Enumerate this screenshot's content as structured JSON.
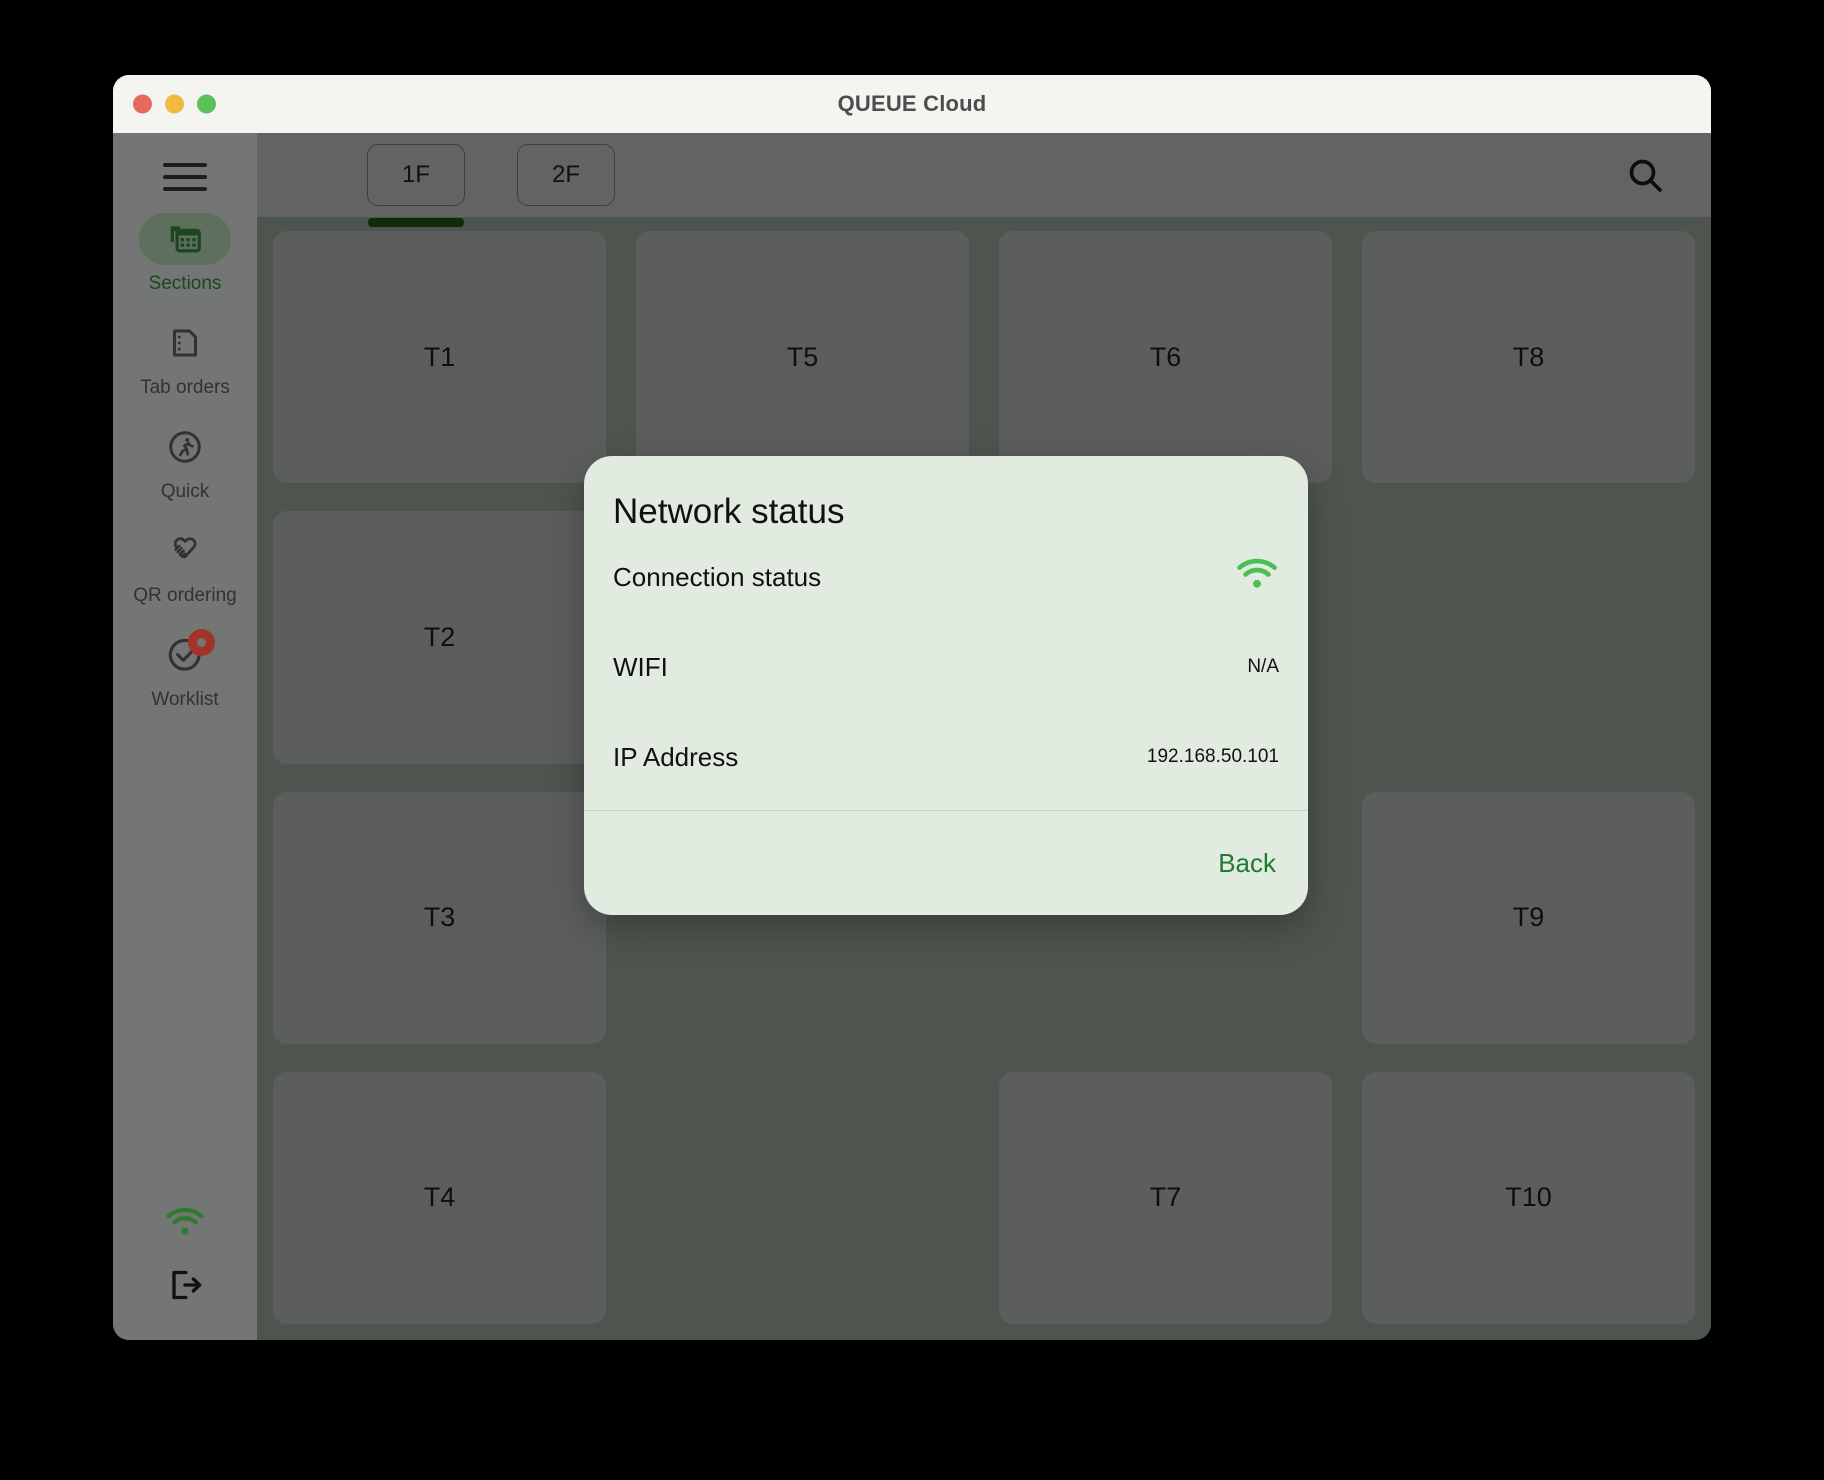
{
  "window": {
    "title": "QUEUE Cloud",
    "traffic_lights": [
      "close",
      "minimize",
      "maximize"
    ]
  },
  "sidebar": {
    "menu_icon": "hamburger-icon",
    "items": [
      {
        "label": "Sections",
        "icon": "sections-icon",
        "active": true,
        "badge": false
      },
      {
        "label": "Tab orders",
        "icon": "document-icon",
        "active": false,
        "badge": false
      },
      {
        "label": "Quick",
        "icon": "runner-icon",
        "active": false,
        "badge": false
      },
      {
        "label": "QR ordering",
        "icon": "handshake-icon",
        "active": false,
        "badge": false
      },
      {
        "label": "Worklist",
        "icon": "check-circle-icon",
        "active": false,
        "badge": true
      }
    ],
    "bottom": [
      {
        "name": "wifi-status-icon",
        "color": "#2f7a2f"
      },
      {
        "name": "logout-icon",
        "color": "#111111"
      }
    ]
  },
  "topbar": {
    "tabs": [
      {
        "label": "1F",
        "active": true
      },
      {
        "label": "2F",
        "active": false
      }
    ],
    "search_icon": "search-icon"
  },
  "grid": {
    "cells": [
      {
        "label": "T1",
        "empty": false
      },
      {
        "label": "T5",
        "empty": false
      },
      {
        "label": "T6",
        "empty": false
      },
      {
        "label": "T8",
        "empty": false
      },
      {
        "label": "T2",
        "empty": false
      },
      {
        "label": "",
        "empty": true
      },
      {
        "label": "",
        "empty": true
      },
      {
        "label": "",
        "empty": true
      },
      {
        "label": "T3",
        "empty": false
      },
      {
        "label": "",
        "empty": true
      },
      {
        "label": "",
        "empty": true
      },
      {
        "label": "T9",
        "empty": false
      },
      {
        "label": "T4",
        "empty": false
      },
      {
        "label": "",
        "empty": true
      },
      {
        "label": "T7",
        "empty": false
      },
      {
        "label": "T10",
        "empty": false
      }
    ]
  },
  "modal": {
    "title": "Network status",
    "rows": [
      {
        "label": "Connection status",
        "value": "",
        "icon": "wifi-icon"
      },
      {
        "label": "WIFI",
        "value": "N/A",
        "icon": ""
      },
      {
        "label": "IP Address",
        "value": "192.168.50.101",
        "icon": ""
      }
    ],
    "back_label": "Back"
  },
  "colors": {
    "accent_green": "#1f7a33",
    "wifi_green": "#4bbf55",
    "badge_red": "#a33328",
    "modal_bg": "#e1ebe0",
    "sidebar_bg": "#737674",
    "content_bg": "#5c665d"
  }
}
